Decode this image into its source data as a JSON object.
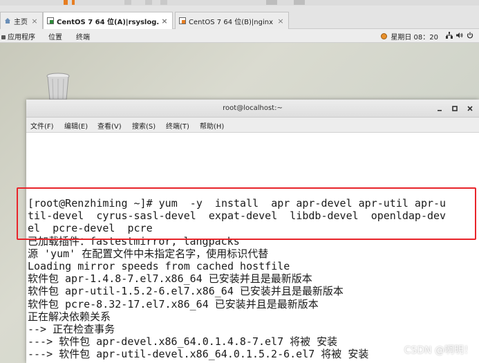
{
  "vmware": {
    "tabs": [
      {
        "label": "主页"
      },
      {
        "label": "CentOS 7 64 位(A)|rsyslog..."
      },
      {
        "label": "CentOS 7 64 位(B)|nginx"
      }
    ],
    "close_glyph": "×"
  },
  "gnome_bar": {
    "applications": "应用程序",
    "places": "位置",
    "terminal": "终端",
    "clock": "星期日 08：20"
  },
  "terminal": {
    "title": "root@localhost:~",
    "menus": [
      "文件(F)",
      "编辑(E)",
      "查看(V)",
      "搜索(S)",
      "终端(T)",
      "帮助(H)"
    ],
    "lines": [
      "[root@Renzhiming ~]# yum  -y  install  apr apr-devel apr-util apr-u",
      "til-devel  cyrus-sasl-devel  expat-devel  libdb-devel  openldap-dev",
      "el  pcre-devel  pcre",
      "已加载插件：fastestmirror, langpacks",
      "源 'yum' 在配置文件中未指定名字，使用标识代替",
      "Loading mirror speeds from cached hostfile",
      "软件包 apr-1.4.8-7.el7.x86_64 已安装并且是最新版本",
      "软件包 apr-util-1.5.2-6.el7.x86_64 已安装并且是最新版本",
      "软件包 pcre-8.32-17.el7.x86_64 已安装并且是最新版本",
      "正在解决依赖关系",
      "--> 正在检查事务",
      "---> 软件包 apr-devel.x86_64.0.1.4.8-7.el7 将被 安装",
      "---> 软件包 apr-util-devel.x86_64.0.1.5.2-6.el7 将被 安装"
    ]
  },
  "watermark": "CSDN @啊明！",
  "colors": {
    "highlight": "#e8242a"
  }
}
